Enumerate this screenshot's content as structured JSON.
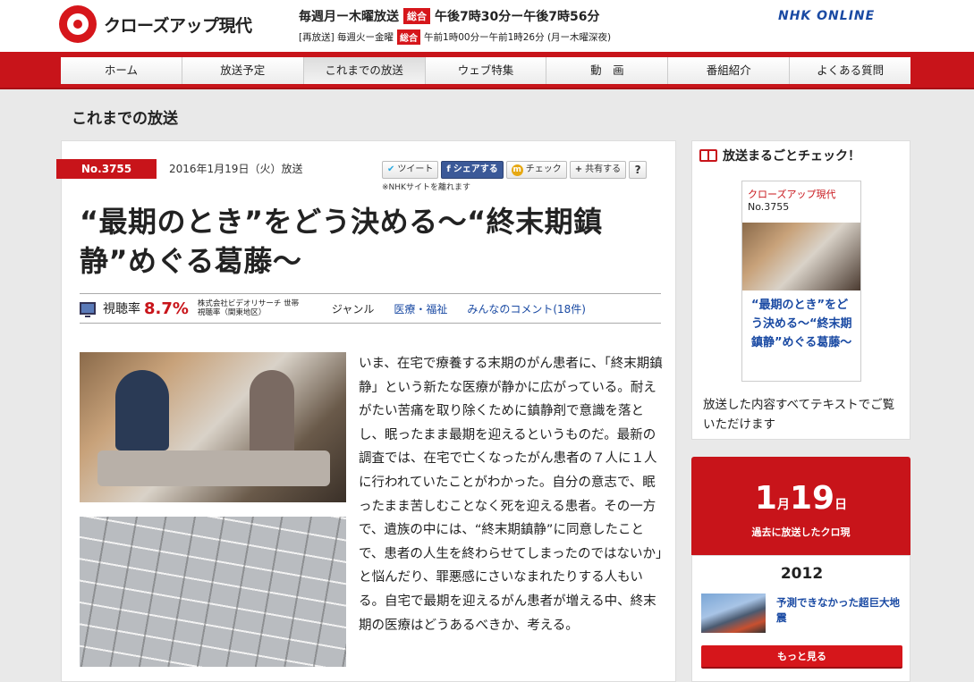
{
  "header": {
    "logo_text": "クローズアップ現代",
    "schedule": {
      "line1_prefix": "毎週月ー木曜放送",
      "line1_badge": "総合",
      "line1_time": "午後7時30分ー午後7時56分",
      "line2_prefix": "[再放送] 毎週火ー金曜",
      "line2_badge": "総合",
      "line2_time": "午前1時00分ー午前1時26分 (月ー木曜深夜)"
    },
    "nhk_online": "NHK ONLINE"
  },
  "nav": {
    "items": [
      "ホーム",
      "放送予定",
      "これまでの放送",
      "ウェブ特集",
      "動　画",
      "番組紹介",
      "よくある質問"
    ],
    "active_index": 2
  },
  "section_title": "これまでの放送",
  "article": {
    "episode_no": "No.3755",
    "date": "2016年1月19日（火）放送",
    "share": {
      "tweet": "ツイート",
      "facebook": "シェアする",
      "mixi": "チェック",
      "plus": "共有する",
      "help": "?",
      "note": "※NHKサイトを離れます"
    },
    "title": "“最期のとき”をどう決める～“終末期鎮静”めぐる葛藤～",
    "rating_label": "視聴率",
    "rating_value": "8.7%",
    "rating_source": "株式会社ビデオリサーチ 世帯視聴率（関東地区）",
    "genre_label": "ジャンル",
    "genre_value": "医療・福祉",
    "comments": "みんなのコメント(18件)",
    "body": "いま、在宅で療養する末期のがん患者に、「終末期鎮静」という新たな医療が静かに広がっている。耐えがたい苦痛を取り除くために鎮静剤で意識を落とし、眠ったまま最期を迎えるというものだ。最新の調査では、在宅で亡くなったがん患者の７人に１人に行われていたことがわかった。自分の意志で、眠ったまま苦しむことなく死を迎える患者。その一方で、遺族の中には、“終末期鎮静”に同意したことで、患者の人生を終わらせてしまったのではないか」と悩んだり、罪悪感にさいなまれたりする人もいる。自宅で最期を迎えるがん患者が増える中、終末期の医療はどうあるべきか、考える。"
  },
  "sidebar": {
    "check_title": "放送まるごとチェック！",
    "card_program": "クローズアップ現代",
    "card_no": "No.3755",
    "card_title": "“最期のとき”をどう決める～“終末期鎮静”めぐる葛藤～",
    "check_desc": "放送した内容すべてテキストでご覧いただけます",
    "past": {
      "month": "1",
      "month_unit": "月",
      "day": "19",
      "day_unit": "日",
      "subtitle": "過去に放送したクロ現",
      "year": "2012",
      "link": "予測できなかった超巨大地震",
      "more": "もっと見る"
    }
  }
}
